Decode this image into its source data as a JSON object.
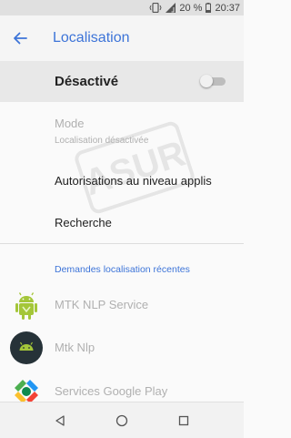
{
  "status": {
    "battery": "20 %",
    "time": "20:37"
  },
  "header": {
    "title": "Localisation"
  },
  "master": {
    "label": "Désactivé",
    "enabled": false
  },
  "mode": {
    "title": "Mode",
    "subtitle": "Localisation désactivée"
  },
  "items": [
    {
      "label": "Autorisations au niveau applis"
    },
    {
      "label": "Recherche"
    }
  ],
  "recent": {
    "header": "Demandes localisation récentes",
    "apps": [
      {
        "label": "MTK NLP Service",
        "icon": "android-icon"
      },
      {
        "label": "Mtk Nlp",
        "icon": "android-circle-icon"
      },
      {
        "label": "Services Google Play",
        "icon": "google-play-services-icon"
      }
    ]
  },
  "watermark": "ASUR",
  "colors": {
    "accent": "#3d74d8",
    "disabled_text": "#b0b0b0",
    "highlight": "#e8e8e8"
  }
}
